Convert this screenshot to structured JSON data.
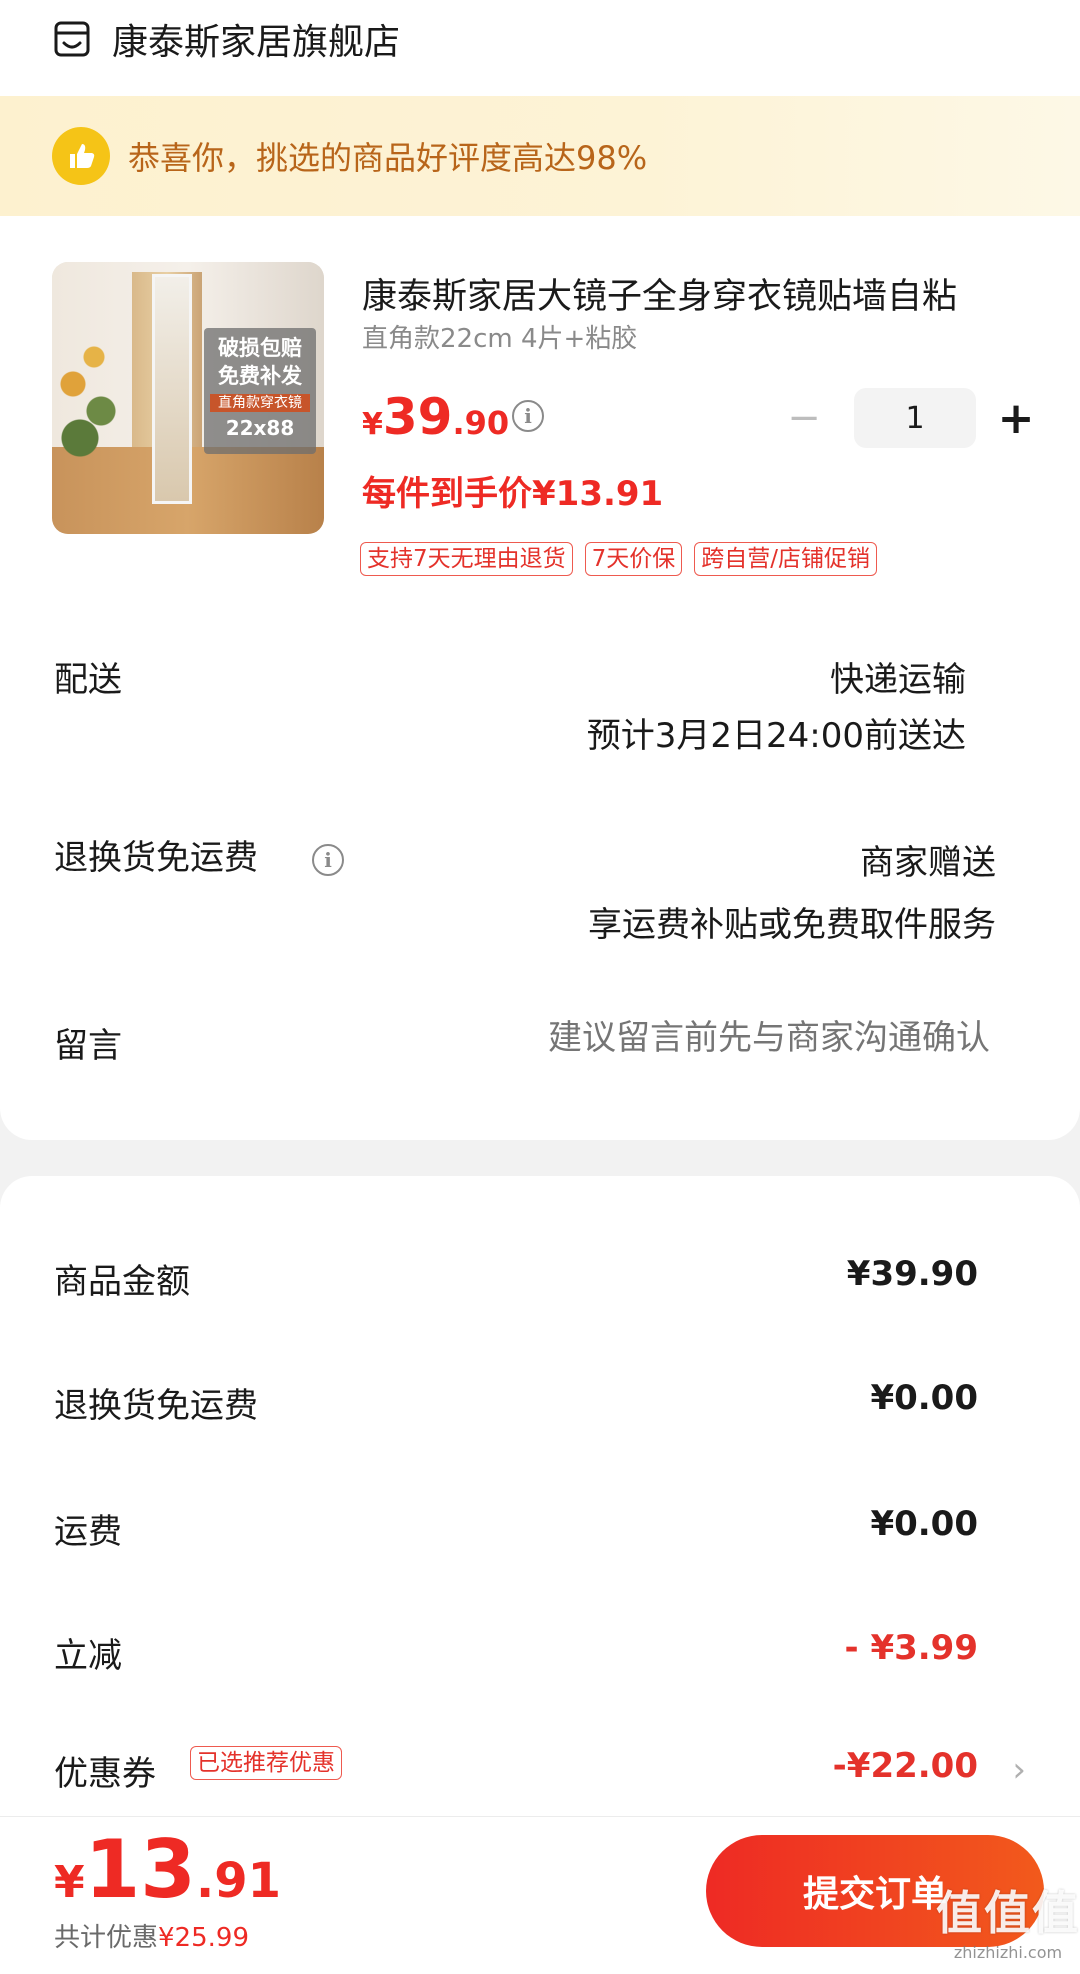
{
  "store": {
    "name": "康泰斯家居旗舰店",
    "icon": "store-icon"
  },
  "banner": {
    "text": "恭喜你，挑选的商品好评度高达98%",
    "icon": "thumbs-up-icon",
    "color": "#b8651a"
  },
  "product": {
    "title": "康泰斯家居大镜子全身穿衣镜贴墙自粘",
    "spec": "直角款22cm 4片+粘胶",
    "price_yen": "¥",
    "price_int": "39",
    "price_dec": ".90",
    "final_price": "每件到手价¥13.91",
    "quantity": "1",
    "image_text": {
      "line1": "破损包赔",
      "line2": "免费补发",
      "line3": "直角款穿衣镜",
      "line4": "22x88"
    },
    "tags": [
      "支持7天无理由退货",
      "7天价保",
      "跨自营/店铺促销"
    ]
  },
  "shipping": {
    "label": "配送",
    "method": "快递运输",
    "eta": "预计3月2日24:00前送达"
  },
  "returns": {
    "label": "退换货免运费",
    "value": "商家赠送",
    "desc": "享运费补贴或免费取件服务"
  },
  "message": {
    "label": "留言",
    "placeholder": "建议留言前先与商家沟通确认"
  },
  "summary": {
    "goods_label": "商品金额",
    "goods_value": "¥39.90",
    "returns_label": "退换货免运费",
    "returns_value": "¥0.00",
    "freight_label": "运费",
    "freight_value": "¥0.00",
    "discount_label": "立减",
    "discount_value": "- ¥3.99",
    "coupon_label": "优惠券",
    "coupon_tag": "已选推荐优惠",
    "coupon_value": "-¥22.00"
  },
  "footer": {
    "total_yen": "¥",
    "total_int": "13",
    "total_dec": ".91",
    "saved_label": "共计优惠",
    "saved_value": "¥25.99",
    "submit_label": "提交订单"
  },
  "watermark": {
    "logo": "值值值",
    "url": "zhizhizhi.com"
  },
  "colors": {
    "accent": "#ee2a24",
    "banner_bg": "#fdf1cf",
    "badge": "#f5c417"
  }
}
